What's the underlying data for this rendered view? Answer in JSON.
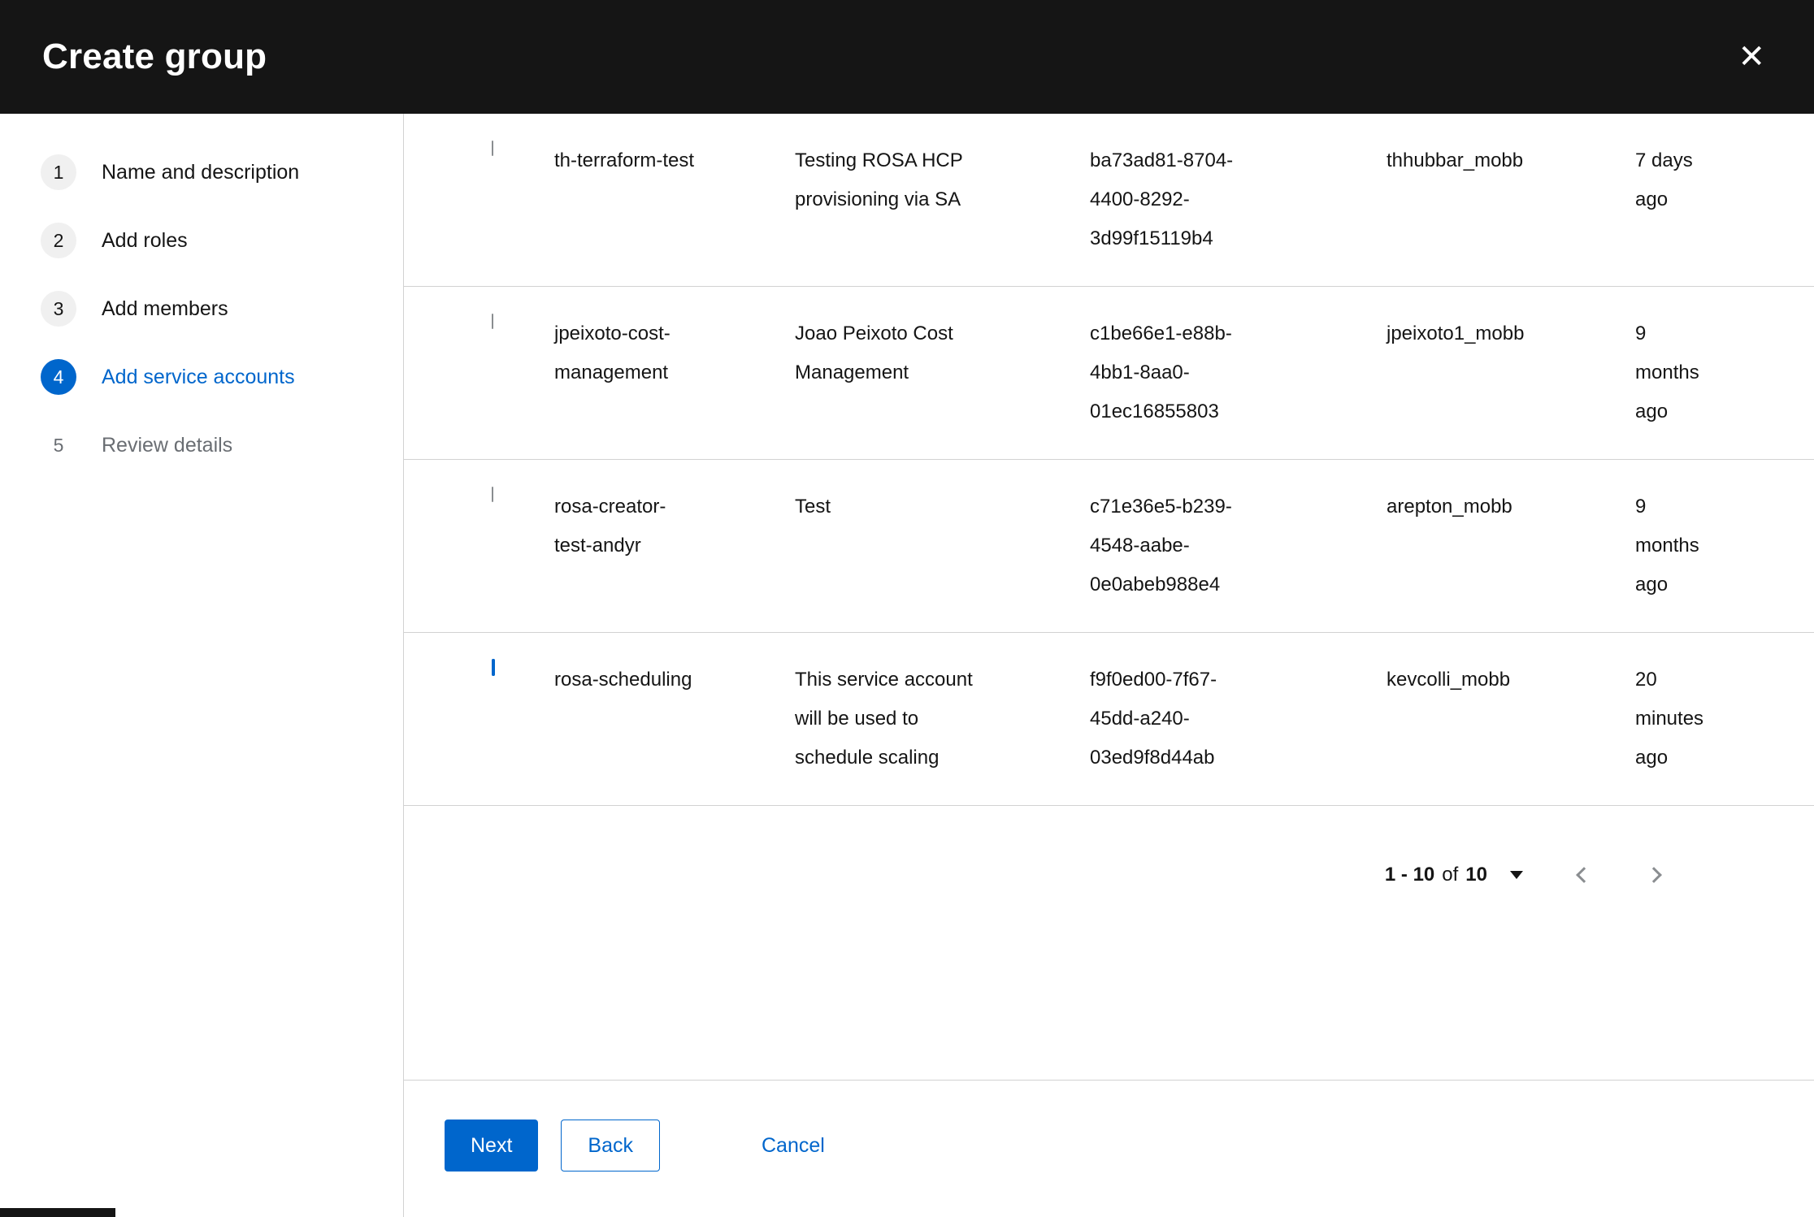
{
  "modal": {
    "title": "Create group",
    "close_icon": "✕"
  },
  "wizard": {
    "steps": [
      {
        "number": "1",
        "label": "Name and description",
        "state": "enabled"
      },
      {
        "number": "2",
        "label": "Add roles",
        "state": "enabled"
      },
      {
        "number": "3",
        "label": "Add members",
        "state": "enabled"
      },
      {
        "number": "4",
        "label": "Add service accounts",
        "state": "current"
      },
      {
        "number": "5",
        "label": "Review details",
        "state": "disabled"
      }
    ]
  },
  "table": {
    "rows": [
      {
        "checked": false,
        "name": "th-terraform-test",
        "description": "Testing ROSA HCP provisioning via SA",
        "client_id": "ba73ad81-8704-4400-8292-3d99f15119b4",
        "owner": "thhubbar_mobb",
        "time_created": "7 days ago"
      },
      {
        "checked": false,
        "name": "jpeixoto-cost-management",
        "description": "Joao Peixoto Cost Management",
        "client_id": "c1be66e1-e88b-4bb1-8aa0-01ec16855803",
        "owner": "jpeixoto1_mobb",
        "time_created": "9 months ago"
      },
      {
        "checked": false,
        "name": "rosa-creator-test-andyr",
        "description": "Test",
        "client_id": "c71e36e5-b239-4548-aabe-0e0abeb988e4",
        "owner": "arepton_mobb",
        "time_created": "9 months ago"
      },
      {
        "checked": true,
        "name": "rosa-scheduling",
        "description": "This service account will be used to schedule scaling",
        "client_id": "f9f0ed00-7f67-45dd-a240-03ed9f8d44ab",
        "owner": "kevcolli_mobb",
        "time_created": "20 minutes ago"
      }
    ]
  },
  "pagination": {
    "range": "1 - 10",
    "of_label": "of",
    "total": "10"
  },
  "footer": {
    "next": "Next",
    "back": "Back",
    "cancel": "Cancel"
  },
  "colors": {
    "accent": "#0066cc",
    "header_bg": "#151515",
    "border": "#d2d2d2"
  }
}
